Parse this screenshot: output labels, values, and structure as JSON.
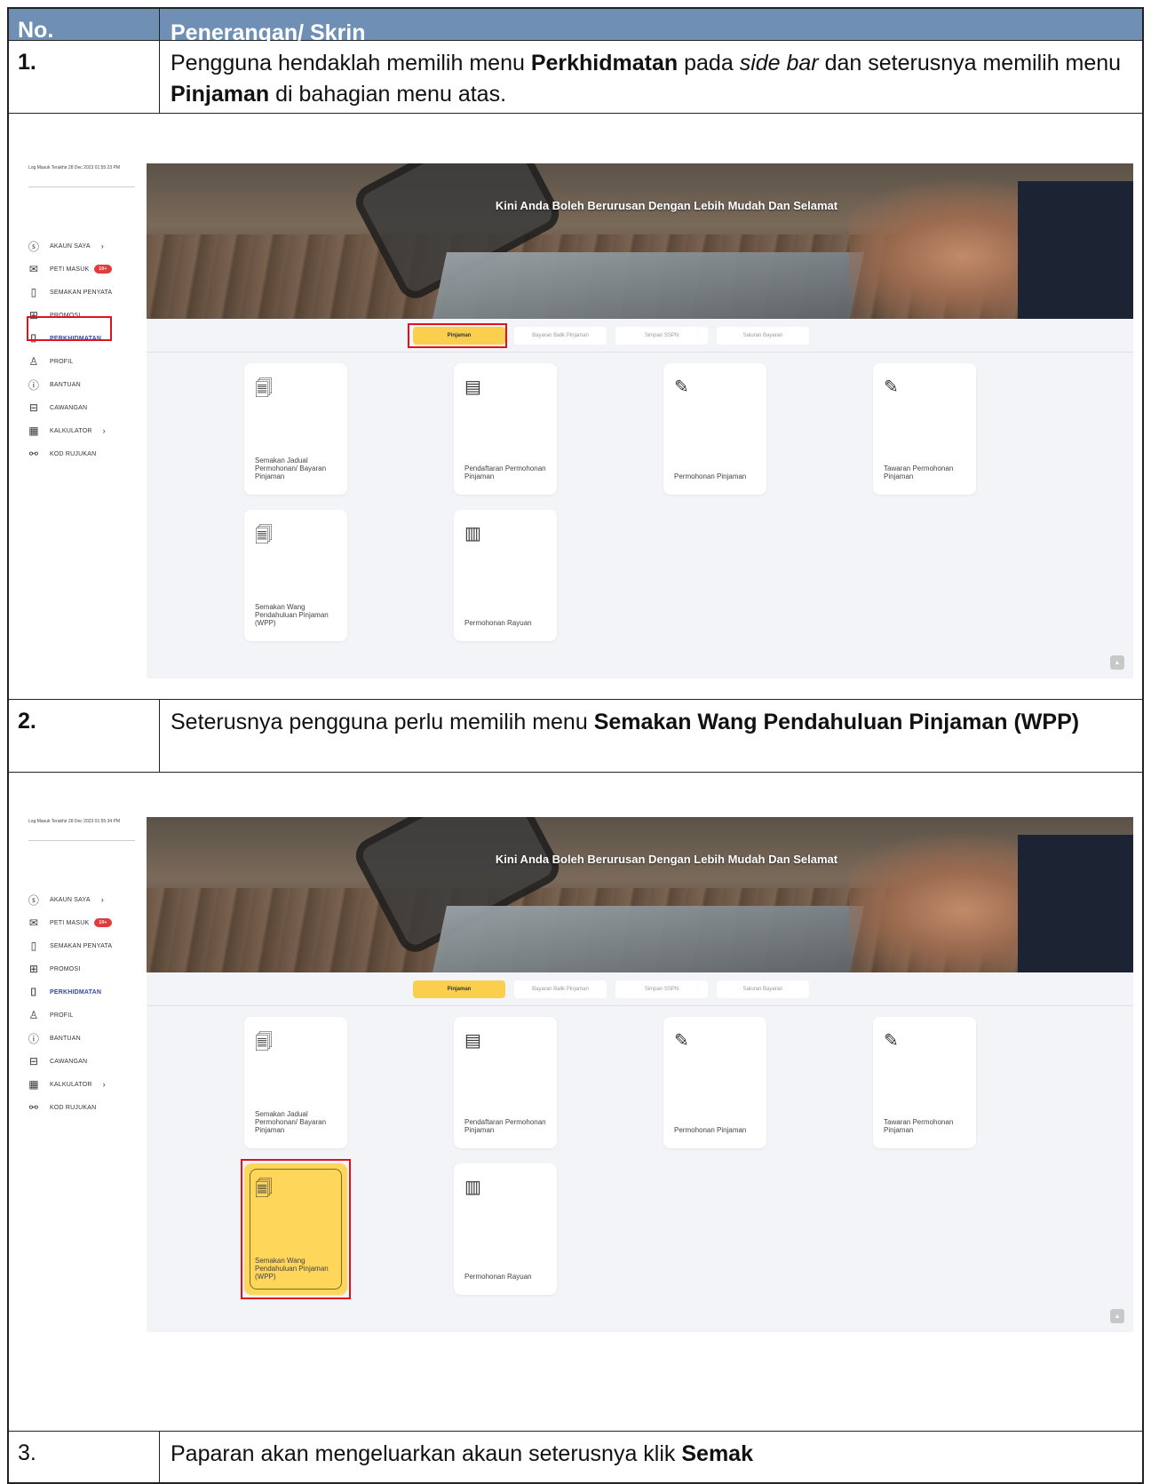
{
  "table": {
    "header": {
      "no": "No.",
      "desc": "Penerangan/ Skrin"
    },
    "rows": [
      {
        "no": "1.",
        "desc_parts": [
          "Pengguna hendaklah memilih menu ",
          "Perkhidmatan",
          " pada ",
          "side bar",
          " dan seterusnya memilih menu ",
          "Pinjaman",
          " di bahagian menu atas."
        ]
      },
      {
        "no": "2.",
        "desc_parts": [
          "Seterusnya pengguna perlu memilih menu ",
          "Semakan Wang Pendahuluan Pinjaman (WPP)"
        ]
      },
      {
        "no": "3.",
        "desc_parts": [
          "Paparan akan mengeluarkan akaun seterusnya klik ",
          "Semak"
        ]
      }
    ]
  },
  "screenshots": [
    {
      "last_login": "Log Masuk Terakhir 28 Dec 2023 01:55:23 PM",
      "banner_title": "Kini Anda Boleh Berurusan Dengan Lebih Mudah Dan Selamat",
      "highlight": "perkhidmatan-and-pinjaman"
    },
    {
      "last_login": "Log Masuk Terakhir 28 Dec 2023 01:55:34 PM",
      "banner_title": "Kini Anda Boleh Berurusan Dengan Lebih Mudah Dan Selamat",
      "highlight": "semakan-wpp-card"
    }
  ],
  "sidebar": {
    "items": [
      {
        "label": "AKAUN SAYA",
        "icon": "dollar-circle-icon",
        "chevron": true
      },
      {
        "label": "PETI MASUK",
        "icon": "mail-icon",
        "badge": "10+"
      },
      {
        "label": "SEMAKAN PENYATA",
        "icon": "document-icon"
      },
      {
        "label": "PROMOSI",
        "icon": "gift-icon"
      },
      {
        "label": "PERKHIDMATAN",
        "icon": "service-icon",
        "active": true
      },
      {
        "label": "PROFIL",
        "icon": "user-icon"
      },
      {
        "label": "BANTUAN",
        "icon": "help-icon"
      },
      {
        "label": "CAWANGAN",
        "icon": "briefcase-icon"
      },
      {
        "label": "KALKULATOR",
        "icon": "calculator-icon",
        "chevron": true
      },
      {
        "label": "KOD RUJUKAN",
        "icon": "link-icon"
      }
    ]
  },
  "tabs": [
    "Pinjaman",
    "Bayaran Balik Pinjaman",
    "Simpan SSPN",
    "Saluran Bayaran"
  ],
  "cards": [
    {
      "label": "Semakan Jadual Permohonan/ Bayaran Pinjaman",
      "icon": "doc-search-icon"
    },
    {
      "label": "Pendaftaran Permohonan Pinjaman",
      "icon": "pin-doc-icon"
    },
    {
      "label": "Permohonan Pinjaman",
      "icon": "doc-edit-icon"
    },
    {
      "label": "Tawaran Permohonan Pinjaman",
      "icon": "doc-edit-icon"
    },
    {
      "label": "Semakan Wang Pendahuluan Pinjaman (WPP)",
      "icon": "doc-magnify-icon"
    },
    {
      "label": "Permohonan Rayuan",
      "icon": "hand-doc-icon"
    }
  ],
  "scroll_top_label": "▲",
  "colors": {
    "header_bg": "#6f8fb5",
    "tab_active": "#f9cf4d",
    "highlight": "#e0121b",
    "active_menu": "#3a47a8"
  }
}
